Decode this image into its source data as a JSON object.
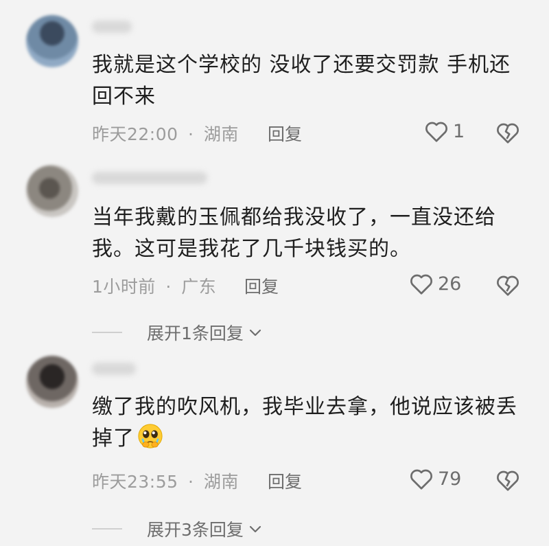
{
  "comments": [
    {
      "text": "我就是这个学校的 没收了还要交罚款 手机还回不来",
      "time": "昨天22:00",
      "location": "湖南",
      "reply_label": "回复",
      "likes": "1"
    },
    {
      "text": "当年我戴的玉佩都给我没收了，一直没还给我。这可是我花了几千块钱买的。",
      "time": "1小时前",
      "location": "广东",
      "reply_label": "回复",
      "likes": "26",
      "expand_label": "展开1条回复"
    },
    {
      "text": "缴了我的吹风机，我毕业去拿，他说应该被丢掉了",
      "time": "昨天23:55",
      "location": "湖南",
      "reply_label": "回复",
      "likes": "79",
      "expand_label": "展开3条回复"
    }
  ],
  "separator": "·",
  "icons": {
    "like": "heart-outline-icon",
    "dislike": "broken-heart-icon",
    "expand": "chevron-down-icon",
    "emoji": "pleading-face-emoji"
  },
  "colors": {
    "background": "#f3f3f3",
    "text": "#1e1e1e",
    "meta": "#9c9c9c",
    "action": "#6d6d6d"
  }
}
